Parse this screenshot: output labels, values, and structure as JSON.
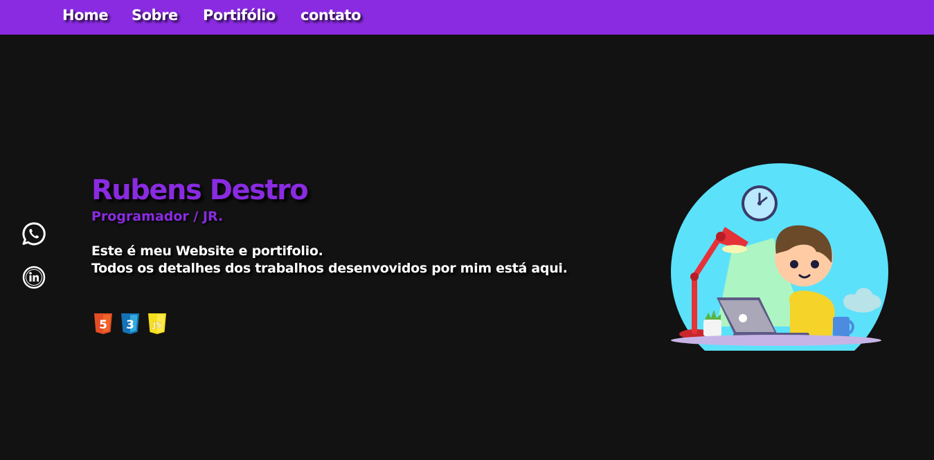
{
  "nav": {
    "items": [
      {
        "label": "Home"
      },
      {
        "label": "Sobre"
      },
      {
        "label": "Portifólio"
      },
      {
        "label": "contato"
      }
    ]
  },
  "social": {
    "icons": [
      "whatsapp-icon",
      "linkedin-icon"
    ]
  },
  "hero": {
    "name": "Rubens Destro",
    "role": "Programador / JR.",
    "description_line1": "Este é meu Website e portifolio.",
    "description_line2": "Todos os detalhes dos trabalhos desenvovidos por mim está aqui."
  },
  "tech": {
    "html_badge": "5",
    "css_badge": "3",
    "js_badge": "JS"
  },
  "colors": {
    "accent": "#8a2be2",
    "background": "#121212",
    "text": "#ffffff",
    "html": "#e44d26",
    "css": "#1572b6",
    "js": "#f7df1e",
    "illustration_circle": "#5ce1fa"
  }
}
